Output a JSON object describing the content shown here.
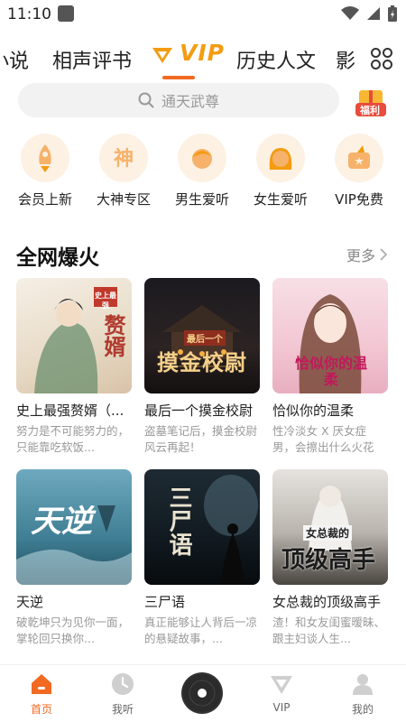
{
  "status_bar": {
    "time": "11:10"
  },
  "tabs": [
    {
      "label": "小说"
    },
    {
      "label": "相声评书"
    },
    {
      "label": "VIP"
    },
    {
      "label": "历史人文"
    },
    {
      "label": "影"
    }
  ],
  "search": {
    "placeholder": "通天武尊",
    "badge_label": "福利"
  },
  "quick_entries": [
    {
      "label": "会员上新",
      "icon": "rocket-icon"
    },
    {
      "label": "大神专区",
      "icon": "shen-icon"
    },
    {
      "label": "男生爱听",
      "icon": "boy-icon"
    },
    {
      "label": "女生爱听",
      "icon": "girl-icon"
    },
    {
      "label": "VIP免费",
      "icon": "vip-thumb-icon"
    }
  ],
  "section": {
    "title": "全网爆火",
    "more": "更多"
  },
  "books": [
    {
      "title": "史上最强赘婿（...",
      "desc": "努力是不可能努力的，只能靠吃软饭...",
      "cover_title": "赘婿",
      "cover_sub": "史上最强"
    },
    {
      "title": "最后一个摸金校尉",
      "desc": "盗墓笔记后，摸金校尉风云再起！",
      "cover_title": "摸金校尉",
      "cover_sub": "最后一个"
    },
    {
      "title": "恰似你的温柔",
      "desc": "性冷淡女 X 厌女症男，会擦出什么火花",
      "cover_title": "恰似你的温柔",
      "cover_sub": ""
    },
    {
      "title": "天逆",
      "desc": "破乾坤只为见你一面，掌轮回只换你...",
      "cover_title": "天逆",
      "cover_sub": ""
    },
    {
      "title": "三尸语",
      "desc": "真正能够让人背后一凉的悬疑故事，...",
      "cover_title": "三尸语",
      "cover_sub": ""
    },
    {
      "title": "女总裁的顶级高手",
      "desc": "渣！和女友闺蜜暧昧、跟主妇谈人生...",
      "cover_title": "顶级高手",
      "cover_sub": "女总裁的"
    }
  ],
  "nav": [
    {
      "label": "首页",
      "icon": "home-icon"
    },
    {
      "label": "我听",
      "icon": "clock-icon"
    },
    {
      "label": "",
      "icon": "disc-icon"
    },
    {
      "label": "VIP",
      "icon": "vip-icon"
    },
    {
      "label": "我的",
      "icon": "user-icon"
    }
  ],
  "colors": {
    "accent": "#f26a21",
    "vip_gold": "#f39c12",
    "search_bg": "#f2f2f2"
  }
}
